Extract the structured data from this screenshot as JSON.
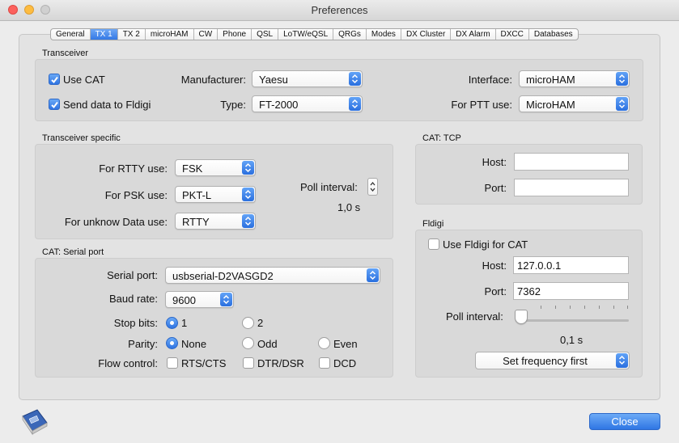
{
  "window": {
    "title": "Preferences"
  },
  "tabs": [
    {
      "label": "General",
      "active": false
    },
    {
      "label": "TX 1",
      "active": true
    },
    {
      "label": "TX 2",
      "active": false
    },
    {
      "label": "microHAM",
      "active": false
    },
    {
      "label": "CW",
      "active": false
    },
    {
      "label": "Phone",
      "active": false
    },
    {
      "label": "QSL",
      "active": false
    },
    {
      "label": "LoTW/eQSL",
      "active": false
    },
    {
      "label": "QRGs",
      "active": false
    },
    {
      "label": "Modes",
      "active": false
    },
    {
      "label": "DX Cluster",
      "active": false
    },
    {
      "label": "DX Alarm",
      "active": false
    },
    {
      "label": "DXCC",
      "active": false
    },
    {
      "label": "Databases",
      "active": false
    }
  ],
  "transceiver": {
    "group_label": "Transceiver",
    "use_cat_label": "Use CAT",
    "use_cat_checked": true,
    "send_data_label": "Send data to Fldigi",
    "send_data_checked": true,
    "manufacturer_label": "Manufacturer:",
    "manufacturer_value": "Yaesu",
    "type_label": "Type:",
    "type_value": "FT-2000",
    "interface_label": "Interface:",
    "interface_value": "microHAM",
    "ptt_label": "For PTT use:",
    "ptt_value": "MicroHAM"
  },
  "transceiver_specific": {
    "group_label": "Transceiver specific",
    "rtty_label": "For RTTY use:",
    "rtty_value": "FSK",
    "psk_label": "For PSK use:",
    "psk_value": "PKT-L",
    "unknown_label": "For unknow Data use:",
    "unknown_value": "RTTY",
    "poll_label": "Poll interval:",
    "poll_value": "1,0 s"
  },
  "cat_tcp": {
    "group_label": "CAT: TCP",
    "host_label": "Host:",
    "host_value": "",
    "port_label": "Port:",
    "port_value": ""
  },
  "cat_serial": {
    "group_label": "CAT: Serial port",
    "serial_label": "Serial port:",
    "serial_value": "usbserial-D2VASGD2",
    "baud_label": "Baud rate:",
    "baud_value": "9600",
    "stop_label": "Stop bits:",
    "stop_options": [
      "1",
      "2"
    ],
    "stop_selected": "1",
    "parity_label": "Parity:",
    "parity_options": [
      "None",
      "Odd",
      "Even"
    ],
    "parity_selected": "None",
    "flow_label": "Flow control:",
    "flow_options": [
      "RTS/CTS",
      "DTR/DSR",
      "DCD"
    ]
  },
  "fldigi": {
    "group_label": "Fldigi",
    "use_label": "Use Fldigi for CAT",
    "use_checked": false,
    "host_label": "Host:",
    "host_value": "127.0.0.1",
    "port_label": "Port:",
    "port_value": "7362",
    "poll_label": "Poll interval:",
    "poll_value": "0,1 s",
    "poll_slider_fraction": 0.0,
    "frequency_value": "Set frequency first"
  },
  "footer": {
    "close_label": "Close"
  },
  "colors": {
    "accent": "#3478e5",
    "window_bg": "#ececec"
  },
  "icons": {
    "app": "log-book-icon"
  }
}
